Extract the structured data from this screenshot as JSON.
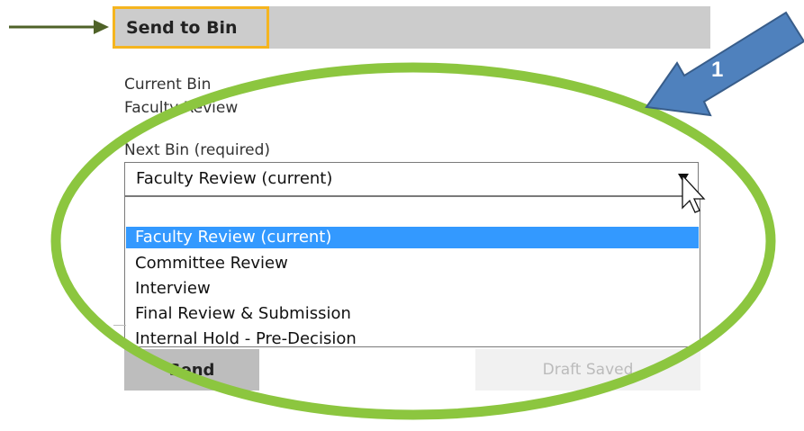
{
  "panel": {
    "title": "Send to Bin",
    "current_bin_label": "Current Bin",
    "current_bin_value": "Faculty Review",
    "next_bin_label": "Next Bin (required)"
  },
  "select": {
    "value": "Faculty Review (current)",
    "options": [
      "Faculty Review (current)",
      "Committee Review",
      "Interview",
      "Final Review & Submission",
      "Internal Hold - Pre-Decision"
    ]
  },
  "actions": {
    "send_label": "Send",
    "draft_label": "Draft Saved"
  },
  "annotation": {
    "step_number": "1",
    "ellipse_color": "#8cc63f",
    "arrow_color": "#4f81bd",
    "pointer_arrow_color": "#4f6228",
    "highlight_color": "#f5b51f"
  }
}
